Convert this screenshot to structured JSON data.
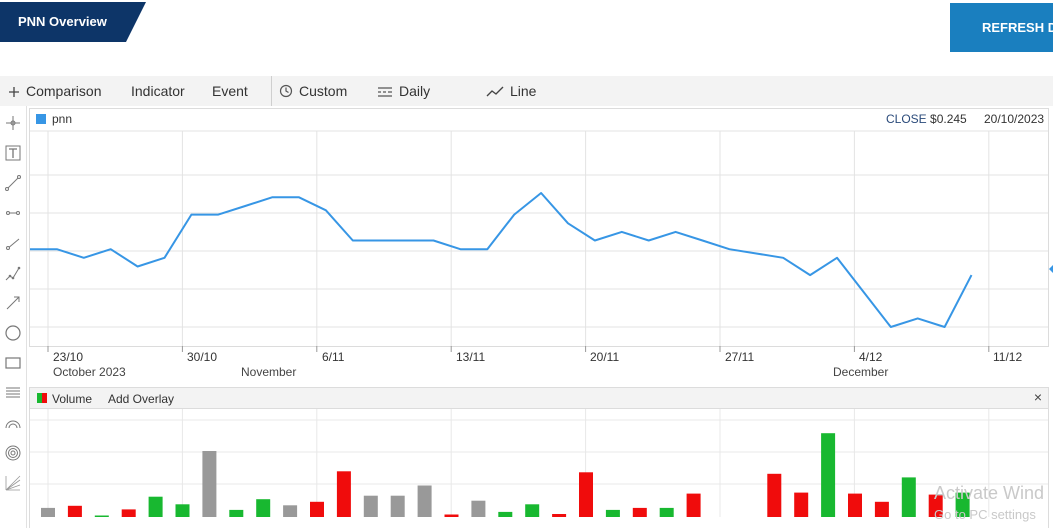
{
  "header": {
    "title": "PNN Overview",
    "refresh_label": "REFRESH D"
  },
  "toolbar": {
    "comparison": "Comparison",
    "indicator": "Indicator",
    "event": "Event",
    "custom": "Custom",
    "daily": "Daily",
    "line": "Line"
  },
  "legend": {
    "series": "pnn",
    "close_key": "CLOSE",
    "close_value": "$0.245",
    "date": "20/10/2023"
  },
  "colors": {
    "series": "#3796e5",
    "up": "#18b830",
    "down": "#f00c0c",
    "neutral": "#999999",
    "brand": "#0d3568",
    "button": "#1a7fbf"
  },
  "xaxis": {
    "ticks": [
      "23/10",
      "30/10",
      "6/11",
      "13/11",
      "20/11",
      "27/11",
      "4/12",
      "11/12"
    ],
    "subs": [
      "October 2023",
      "November",
      "December"
    ]
  },
  "volume_panel": {
    "label": "Volume",
    "add_overlay": "Add Overlay",
    "close": "×"
  },
  "watermark": {
    "line1": "Activate Wind",
    "line2": "Go to PC settings"
  },
  "chart_data": [
    {
      "type": "line",
      "series": [
        {
          "name": "pnn",
          "values": [
            0.264,
            0.264,
            0.262,
            0.264,
            0.26,
            0.262,
            0.272,
            0.272,
            0.274,
            0.276,
            0.276,
            0.273,
            0.266,
            0.266,
            0.266,
            0.266,
            0.264,
            0.264,
            0.272,
            0.277,
            0.27,
            0.266,
            0.268,
            0.266,
            0.268,
            0.266,
            0.264,
            0.263,
            0.262,
            0.258,
            0.262,
            0.254,
            0.246,
            0.248,
            0.246,
            0.258
          ]
        }
      ],
      "x_tick_labels": [
        "23/10",
        "30/10",
        "6/11",
        "13/11",
        "20/11",
        "27/11",
        "4/12",
        "11/12"
      ]
    },
    {
      "type": "bar",
      "title": "Volume",
      "values": [
        18,
        22,
        3,
        15,
        40,
        25,
        130,
        14,
        35,
        23,
        30,
        90,
        42,
        42,
        62,
        5,
        32,
        10,
        25,
        6,
        88,
        14,
        18,
        18,
        46,
        0,
        0,
        85,
        48,
        165,
        46,
        30,
        78,
        44,
        48
      ],
      "direction": [
        "n",
        "d",
        "u",
        "d",
        "u",
        "u",
        "n",
        "u",
        "u",
        "n",
        "d",
        "d",
        "n",
        "n",
        "n",
        "d",
        "n",
        "u",
        "u",
        "d",
        "d",
        "u",
        "d",
        "u",
        "d",
        "n",
        "n",
        "d",
        "d",
        "u",
        "d",
        "d",
        "u",
        "d",
        "u"
      ]
    }
  ]
}
